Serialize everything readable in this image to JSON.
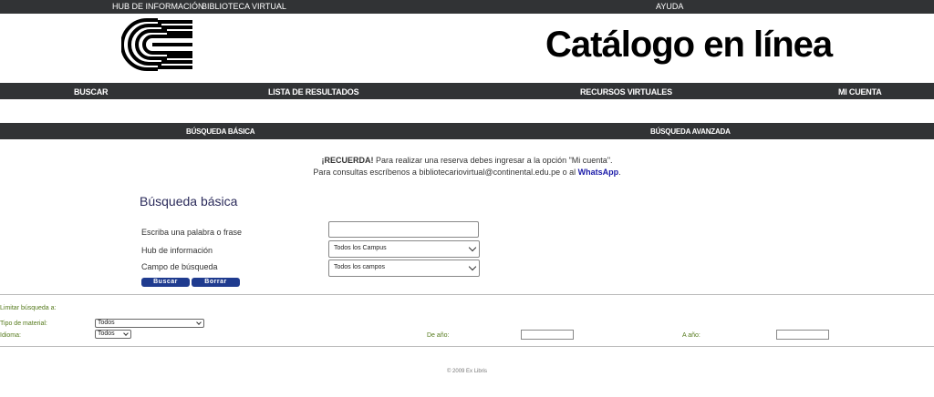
{
  "topbar": {
    "hub": "HUB DE INFORMACIÓN",
    "biblioteca": "BIBLIOTECA VIRTUAL",
    "ayuda": "AYUDA"
  },
  "header": {
    "title": "Catálogo en línea"
  },
  "nav": {
    "buscar": "BUSCAR",
    "lista": "LISTA DE RESULTADOS",
    "recursos": "RECURSOS VIRTUALES",
    "cuenta": "MI CUENTA"
  },
  "subnav": {
    "basica": "BÚSQUEDA BÁSICA",
    "avanzada": "BÚSQUEDA AVANZADA"
  },
  "notice": {
    "recuerda": "¡RECUERDA!",
    "line1_rest": " Para realizar una reserva debes ingresar a la opción \"Mi cuenta\".",
    "line2_prefix": "Para consultas escríbenos a bibliotecariovirtual@continental.edu.pe o al ",
    "whatsapp": "WhatsApp",
    "line2_suffix": "."
  },
  "search": {
    "section_title": "Búsqueda básica",
    "phrase_label": "Escriba una palabra o frase",
    "phrase_value": "",
    "hub_label": "Hub de información",
    "hub_selected": "Todos los Campus",
    "field_label": "Campo de búsqueda",
    "field_selected": "Todos los campos",
    "buscar_btn": "Buscar",
    "borrar_btn": "Borrar"
  },
  "limit": {
    "title": "Limitar búsqueda a:",
    "tipo_label": "Tipo de material:",
    "tipo_selected": "Todos",
    "idioma_label": "Idioma:",
    "idioma_selected": "Todos",
    "de_anio_label": "De año:",
    "a_anio_label": "A año:"
  },
  "footer": {
    "copyright": "© 2009 Ex Libris"
  }
}
